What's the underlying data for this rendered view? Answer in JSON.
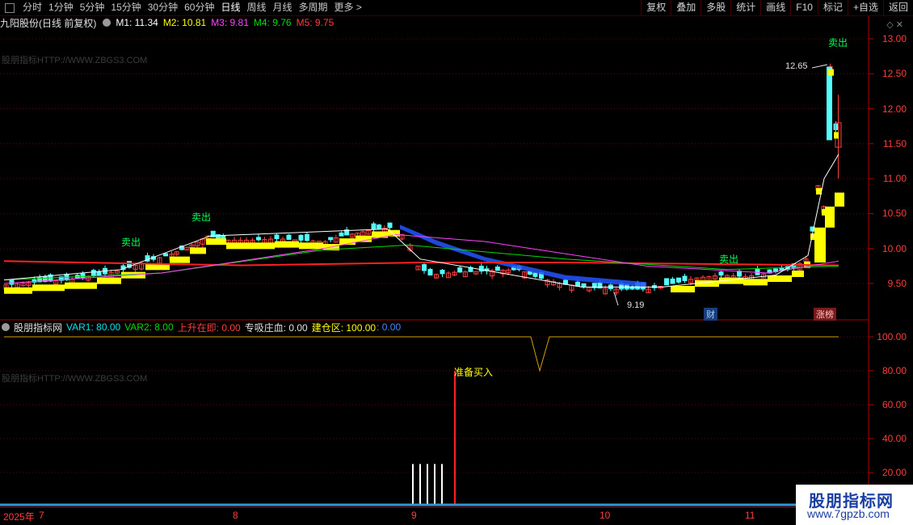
{
  "toolbar": {
    "tabs": [
      {
        "label": "分时"
      },
      {
        "label": "1分钟"
      },
      {
        "label": "5分钟"
      },
      {
        "label": "15分钟"
      },
      {
        "label": "30分钟"
      },
      {
        "label": "60分钟"
      },
      {
        "label": "日线"
      },
      {
        "label": "周线"
      },
      {
        "label": "月线"
      },
      {
        "label": "多周期"
      },
      {
        "label": "更多"
      }
    ],
    "right_buttons": [
      {
        "label": "复权"
      },
      {
        "label": "叠加"
      },
      {
        "label": "多股"
      },
      {
        "label": "统计"
      },
      {
        "label": "画线"
      },
      {
        "label": "F10"
      },
      {
        "label": "标记"
      },
      {
        "label": "+自选"
      },
      {
        "label": "返回"
      }
    ]
  },
  "main_chart": {
    "stock_title": "九阳股份(日线 前复权)",
    "ma": [
      {
        "label": "M1: 11.34",
        "color": "#ffffff"
      },
      {
        "label": "M2: 10.81",
        "color": "#ffff00"
      },
      {
        "label": "M3: 9.81",
        "color": "#ff44ff"
      },
      {
        "label": "M4: 9.76",
        "color": "#00dd00"
      },
      {
        "label": "M5: 9.75",
        "color": "#ff3c3c"
      }
    ],
    "watermark": "股朋指标HTTP://WWW.ZBGS3.COM",
    "price_axis": [
      "13.00",
      "12.50",
      "12.00",
      "11.50",
      "11.00",
      "10.50",
      "10.00",
      "9.50"
    ],
    "high_label": "12.65",
    "low_label": "9.19",
    "sell_signals": [
      "卖出",
      "卖出",
      "卖出",
      "卖出"
    ],
    "badges": {
      "cai": "财",
      "zhangbang": "涨榜"
    }
  },
  "indicator": {
    "name": "股朋指标网",
    "values": [
      {
        "label": "VAR1: 80.00",
        "color": "#e0e0e0"
      },
      {
        "label": "VAR2: 8.00",
        "color": "#00dd00"
      },
      {
        "label": "上升在即: 0.00",
        "color": "#ff3c3c"
      },
      {
        "label": "专吸庄血: 0.00",
        "color": "#e0e0e0"
      },
      {
        "label": "建仓区: 100.00",
        "color": "#ffff00"
      },
      {
        "label": ": 0.00",
        "color": "#4488ff"
      }
    ],
    "watermark": "股朋指标HTTP://WWW.ZBGS3.COM",
    "axis": [
      "100.00",
      "80.00",
      "60.00",
      "40.00",
      "20.00"
    ],
    "annotation": "准备买入"
  },
  "dates": [
    "2025年",
    "7",
    "8",
    "9",
    "10",
    "11"
  ],
  "logo": {
    "title": "股朋指标网",
    "url": "www.7gpzb.com"
  }
}
